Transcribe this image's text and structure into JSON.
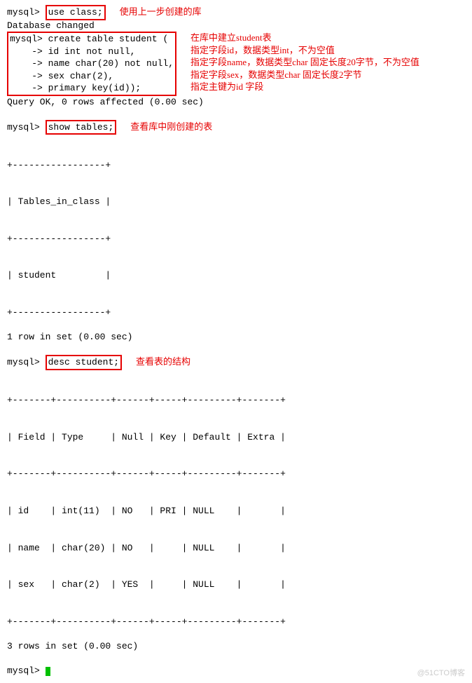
{
  "prompt": "mysql>",
  "cmds": {
    "use_class": "use class;",
    "db_changed": "Database changed",
    "create_line": "create table student (",
    "ct1": "    -> id int not null,",
    "ct2": "    -> name char(20) not null,",
    "ct3": "    -> sex char(2),",
    "ct4": "    -> primary key(id));",
    "query_ok": "Query OK, 0 rows affected (0.00 sec)",
    "show_tables": "show tables;",
    "desc_student": "desc student;"
  },
  "annots": {
    "use_db": "使用上一步创建的库",
    "create_header": "在库中建立student表",
    "field_id": "指定字段id，数据类型int，不为空值",
    "field_name": "指定字段name，数据类型char 固定长度20字节，不为空值",
    "field_sex": "指定字段sex，数据类型char 固定长度2字节",
    "field_pk": "指定主键为id 字段",
    "show_tables": "查看库中刚创建的表",
    "desc": "查看表的结构"
  },
  "tables_output": {
    "border": "+-----------------+",
    "header": "| Tables_in_class |",
    "row": "| student         |",
    "footer": "1 row in set (0.00 sec)"
  },
  "desc_output": {
    "border": "+-------+----------+------+-----+---------+-------+",
    "header": "| Field | Type     | Null | Key | Default | Extra |",
    "r1": "| id    | int(11)  | NO   | PRI | NULL    |       |",
    "r2": "| name  | char(20) | NO   |     | NULL    |       |",
    "r3": "| sex   | char(2)  | YES  |     | NULL    |       |",
    "footer": "3 rows in set (0.00 sec)"
  },
  "watermark": "@51CTO博客"
}
